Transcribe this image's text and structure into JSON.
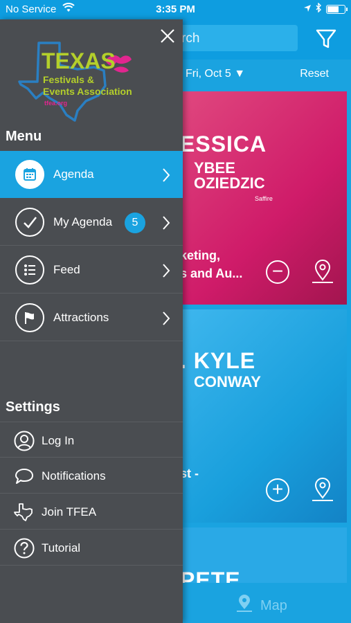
{
  "status_bar": {
    "carrier": "No Service",
    "time": "3:35 PM"
  },
  "header": {
    "search_placeholder": "rch",
    "date": "Fri, Oct 5",
    "reset": "Reset"
  },
  "cards": [
    {
      "title_line1": "ESSICA",
      "title_line2": "YBEE",
      "title_line3": "OZIEDZIC",
      "tag": "Saffire",
      "caption_line1": "keting,",
      "caption_line2": "s and Au...",
      "action": "remove"
    },
    {
      "title_line1": ". KYLE",
      "title_line2": "CONWAY",
      "caption_line1": "st -",
      "action": "add"
    },
    {
      "title_line1": "PETE"
    }
  ],
  "bottom_bar": {
    "map_label": "Map"
  },
  "drawer": {
    "logo": {
      "line1": "TEXAS",
      "line2": "Festivals &",
      "line3": "Events Association",
      "line4": "tfea.org"
    },
    "menu_title": "Menu",
    "menu_items": [
      {
        "label": "Agenda",
        "icon": "calendar-icon",
        "active": true
      },
      {
        "label": "My Agenda",
        "icon": "checkmark-icon",
        "badge": "5"
      },
      {
        "label": "Feed",
        "icon": "list-icon"
      },
      {
        "label": "Attractions",
        "icon": "flag-icon"
      }
    ],
    "settings_title": "Settings",
    "settings_items": [
      {
        "label": "Log In",
        "icon": "user-icon"
      },
      {
        "label": "Notifications",
        "icon": "chat-bubble-icon"
      },
      {
        "label": "Join TFEA",
        "icon": "texas-outline-icon"
      },
      {
        "label": "Tutorial",
        "icon": "question-icon"
      }
    ]
  },
  "colors": {
    "accent": "#1aa3e0",
    "drawer_bg": "#4a4d51",
    "card_pink": "#cf1b69",
    "card_blue": "#199fdc",
    "logo_green": "#b4cf2b",
    "logo_pink": "#e1268f",
    "logo_blue": "#2a7fc2"
  }
}
